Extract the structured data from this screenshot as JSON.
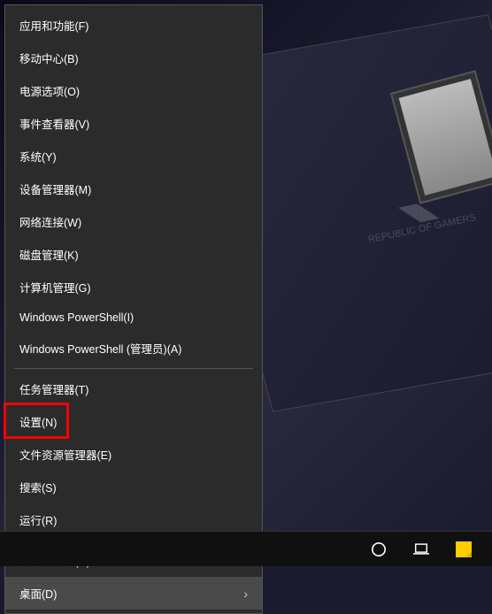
{
  "menu": {
    "groups": [
      [
        "应用和功能(F)",
        "移动中心(B)",
        "电源选项(O)",
        "事件查看器(V)",
        "系统(Y)",
        "设备管理器(M)",
        "网络连接(W)",
        "磁盘管理(K)",
        "计算机管理(G)",
        "Windows PowerShell(I)",
        "Windows PowerShell (管理员)(A)"
      ],
      [
        "任务管理器(T)",
        "设置(N)",
        "文件资源管理器(E)",
        "搜索(S)",
        "运行(R)"
      ],
      [
        {
          "label": "关机或注销(U)",
          "hasSubmenu": true
        },
        {
          "label": "桌面(D)",
          "hasSubmenu": true,
          "hovered": true
        }
      ]
    ],
    "highlightedIndex": {
      "group": 1,
      "item": 1
    }
  },
  "bg": {
    "logoText": "REPUBLIC OF\nGAMERS"
  }
}
